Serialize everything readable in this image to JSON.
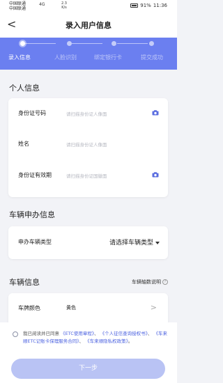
{
  "status_bar": {
    "carrier_line1": "中国联通",
    "carrier_line2": "中国联通",
    "signal_text": "4G",
    "net_speed": "2.3",
    "net_unit": "K/s",
    "battery": "91%",
    "time": "11:36"
  },
  "navbar": {
    "back_glyph": "<",
    "title": "录入用户信息"
  },
  "steps": [
    {
      "label": "录入信息",
      "active": true
    },
    {
      "label": "人脸识别",
      "active": false
    },
    {
      "label": "绑定银行卡",
      "active": false
    },
    {
      "label": "提交成功",
      "active": false
    }
  ],
  "personal": {
    "title": "个人信息",
    "id_number_label": "身份证号码",
    "id_number_placeholder": "请扫描身份证人像面",
    "name_label": "姓名",
    "name_placeholder": "请扫描身份证人像面",
    "validity_label": "身份证有效期",
    "validity_placeholder": "请扫描身份证国徽面",
    "camera_icon": "camera-icon"
  },
  "vehicle_apply": {
    "title": "车辆申办信息",
    "type_label": "申办车辆类型",
    "type_value": "请选择车辆类型"
  },
  "vehicle": {
    "title": "车辆信息",
    "axle_link": "车辆轴数说明",
    "help_glyph": "?",
    "plate_color_label": "车牌颜色",
    "plate_color_value": "黄色",
    "chevron": ">"
  },
  "agreement": {
    "prefix": "我已阅读并已同意",
    "link1": "《ETC使用章程》",
    "sep1": "、",
    "link2": "《个人征信查询授权书》",
    "sep2": "、",
    "link3": "《车来顺ETC记账卡保理服务合同》",
    "sep3": "、",
    "link4": "《车来顺隐私权政策》",
    "suffix": "。"
  },
  "next_button": "下一步",
  "colors": {
    "accent": "#6b7ff0",
    "link": "#4d63e0",
    "button_disabled": "#b9c3f4"
  }
}
